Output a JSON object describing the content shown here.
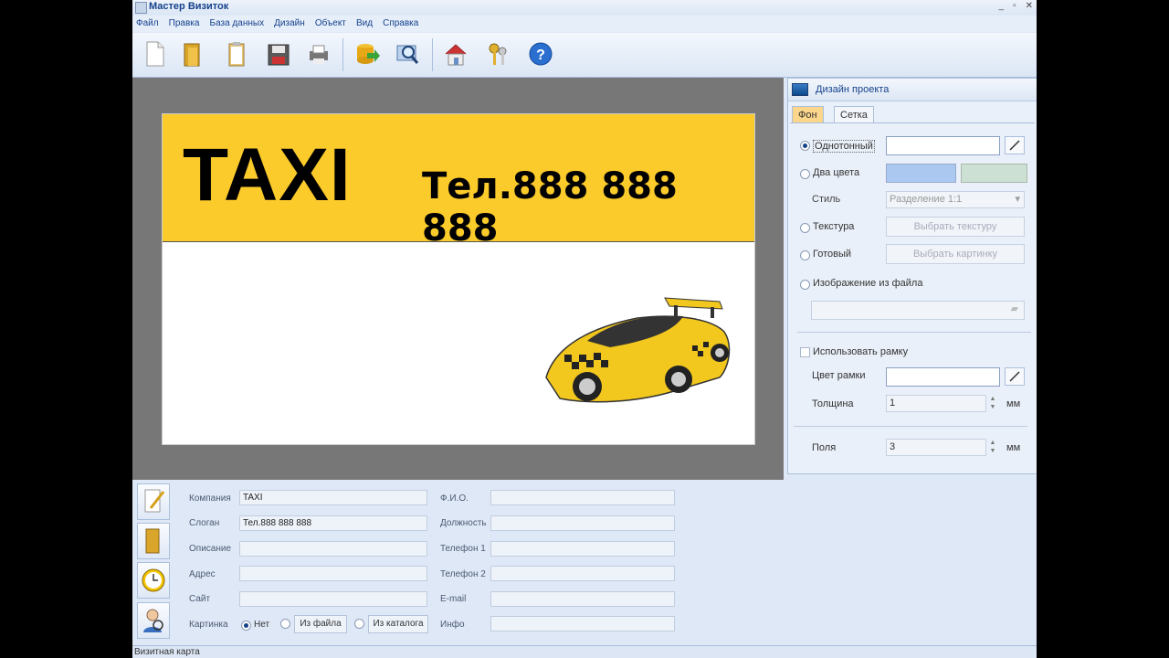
{
  "window": {
    "title": "Мастер Визиток",
    "controls": [
      "_",
      "▫",
      "✕"
    ]
  },
  "menu": [
    "Файл",
    "Правка",
    "База данных",
    "Дизайн",
    "Объект",
    "Вид",
    "Справка"
  ],
  "toolbar": [
    "new-file-icon",
    "open-folder-icon",
    "clipboard-icon",
    "save-icon",
    "print-icon",
    "database-export-icon",
    "search-icon",
    "home-icon",
    "keys-icon",
    "help-icon"
  ],
  "card": {
    "company": "TAXI",
    "slogan": "Тел.888 888 888",
    "band_color": "#fbca2b"
  },
  "design_panel": {
    "title": "Дизайн проекта",
    "tabs": [
      "Фон",
      "Сетка"
    ],
    "options": {
      "solid": "Однотонный",
      "two_color": "Два цвета",
      "style_label": "Стиль",
      "style_value": "Разделение 1:1",
      "texture": "Текстура",
      "texture_btn": "Выбрать текстуру",
      "ready": "Готовый",
      "ready_btn": "Выбрать картинку",
      "from_file": "Изображение из файла"
    },
    "use_frame": "Использовать рамку",
    "frame_color": "Цвет рамки",
    "thickness_label": "Толщина",
    "thickness_value": "1",
    "margins_label": "Поля",
    "margins_value": "3",
    "unit": "мм",
    "two_colors": [
      "#aac8f0",
      "#cde0d4"
    ]
  },
  "form": {
    "company_label": "Компания",
    "company_value": "TAXI",
    "slogan_label": "Слоган",
    "slogan_value": "Тел.888 888 888",
    "description_label": "Описание",
    "address_label": "Адрес",
    "site_label": "Сайт",
    "picture_label": "Картинка",
    "picture_none": "Нет",
    "picture_from_file": "Из файла",
    "picture_from_catalog": "Из каталога",
    "fio_label": "Ф.И.О.",
    "position_label": "Должность",
    "phone1_label": "Телефон 1",
    "phone2_label": "Телефон 2",
    "email_label": "E-mail",
    "info_label": "Инфо"
  },
  "status": "Визитная карта"
}
